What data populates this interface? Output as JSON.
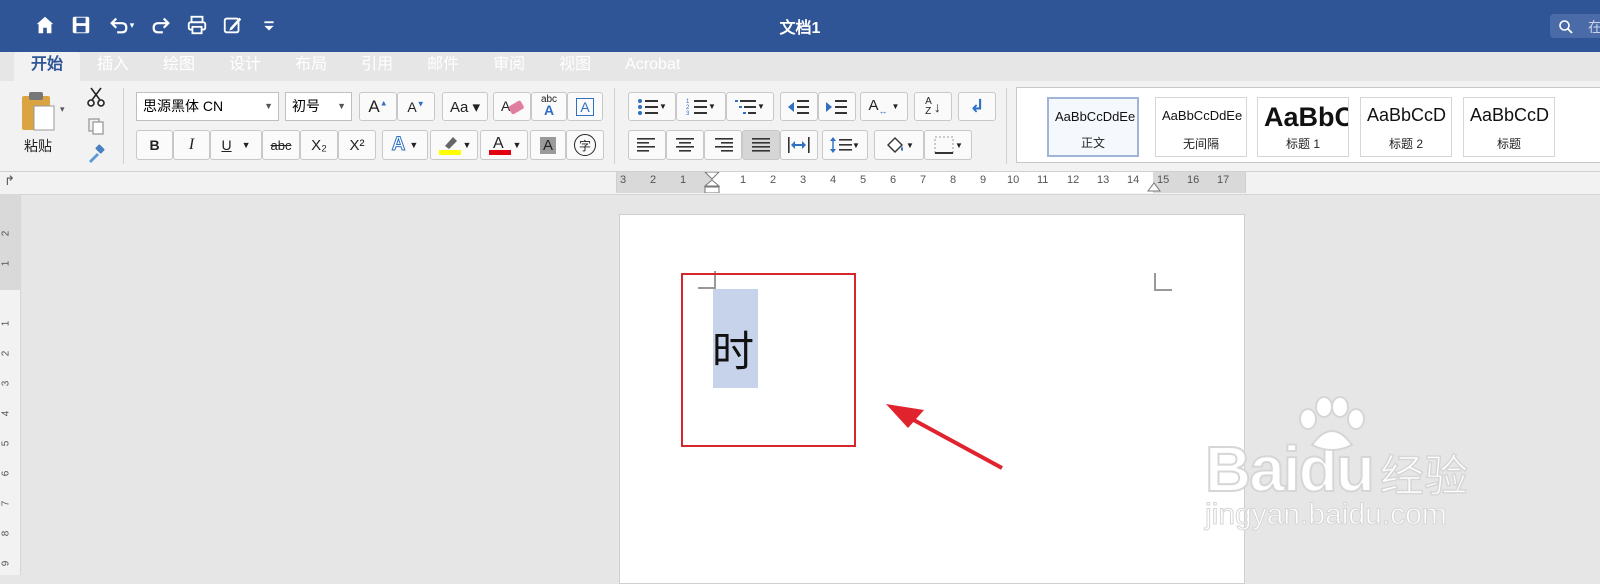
{
  "window": {
    "title": "文档1",
    "search_placeholder": "在"
  },
  "colors": {
    "title_bar": "#2f5597",
    "ribbon": "#f2f2f2",
    "selection": "#c6d3ea",
    "annotation": "#d6272f"
  },
  "ribbon_tabs": [
    {
      "label": "开始",
      "active": true
    },
    {
      "label": "插入"
    },
    {
      "label": "绘图"
    },
    {
      "label": "设计"
    },
    {
      "label": "布局"
    },
    {
      "label": "引用"
    },
    {
      "label": "邮件"
    },
    {
      "label": "审阅"
    },
    {
      "label": "视图"
    },
    {
      "label": "Acrobat"
    }
  ],
  "clipboard": {
    "paste_label": "粘贴"
  },
  "font": {
    "family": "思源黑体 CN",
    "size": "初号"
  },
  "font_buttons": {
    "bold": "B",
    "italic": "I",
    "underline": "U",
    "strike": "abc",
    "subscript": "X₂",
    "superscript": "X²",
    "char_border": "字",
    "shade": "A",
    "clear": "abc"
  },
  "styles": [
    {
      "sample": "AaBbCcDdEe",
      "name": "正文",
      "selected": true
    },
    {
      "sample": "AaBbCcDdEe",
      "name": "无间隔"
    },
    {
      "sample": "AaBbC",
      "name": "标题 1"
    },
    {
      "sample": "AaBbCcD",
      "name": "标题 2"
    },
    {
      "sample": "AaBbCcD",
      "name": "标题"
    }
  ],
  "ruler_h": [
    "3",
    "2",
    "1",
    "1",
    "2",
    "3",
    "4",
    "5",
    "6",
    "7",
    "8",
    "9",
    "10",
    "11",
    "12",
    "13",
    "14",
    "15",
    "16",
    "17"
  ],
  "ruler_v": [
    "2",
    "1",
    "1",
    "2",
    "3",
    "4",
    "5",
    "6",
    "7",
    "8",
    "9"
  ],
  "document": {
    "selected_text": "时"
  },
  "watermark": {
    "brand": "Bai",
    "brand2": "du",
    "product": "经验",
    "url": "jingyan.baidu.com"
  }
}
